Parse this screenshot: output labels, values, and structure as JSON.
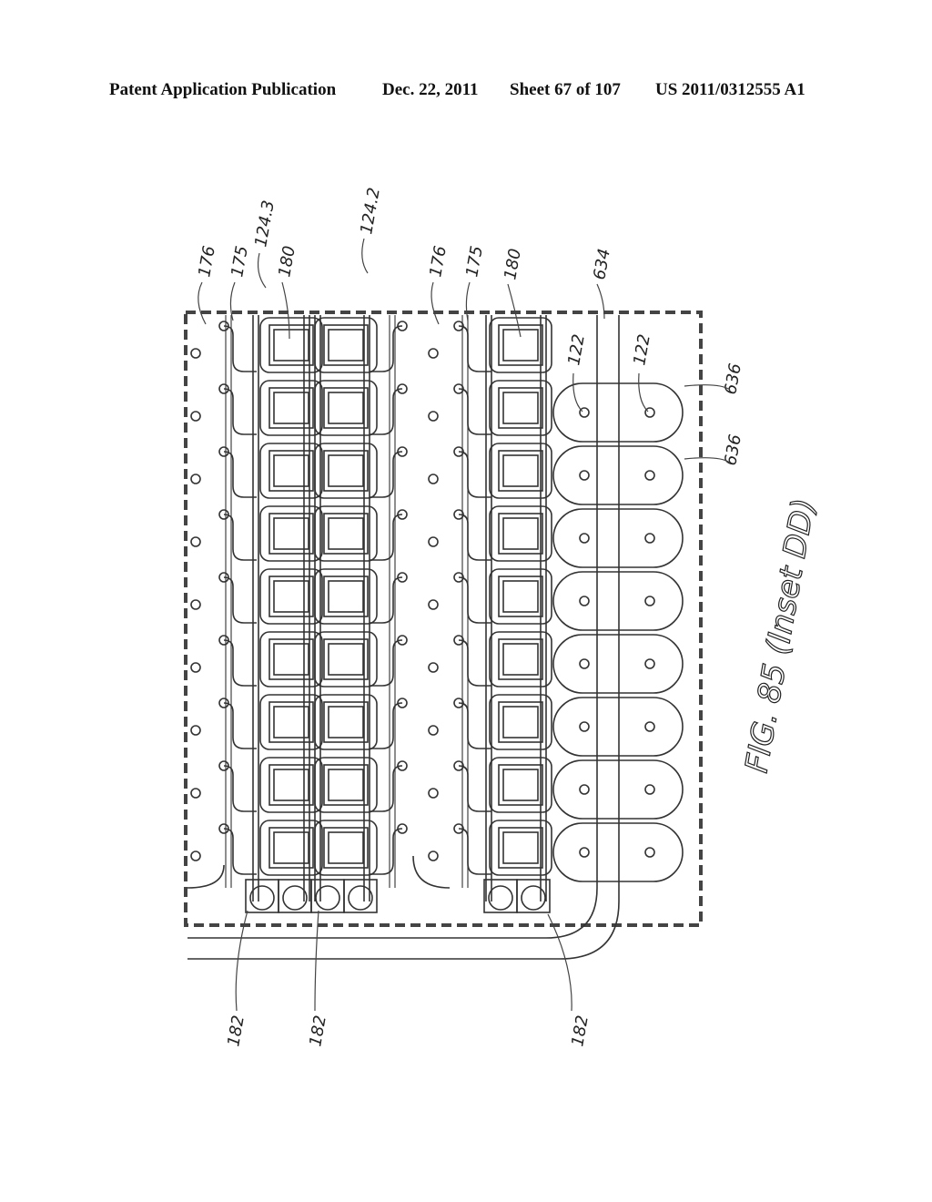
{
  "header": {
    "publication": "Patent Application Publication",
    "date": "Dec. 22, 2011",
    "sheet": "Sheet 67 of 107",
    "number": "US 2011/0312555 A1"
  },
  "figure": {
    "caption": "FIG. 85 (Inset DD)",
    "rows": 9,
    "chamber_columns": 3,
    "bubble_pairs": 8,
    "reference_labels": {
      "left_176": "176",
      "left_175": "175",
      "group_124_3": "124.3",
      "left_180": "180",
      "group_124_2": "124.2",
      "mid_176": "176",
      "mid_175": "175",
      "mid_180": "180",
      "channel_634": "634",
      "via_122_a": "122",
      "via_122_b": "122",
      "cell_636_a": "636",
      "cell_636_b": "636",
      "valve_182_a": "182",
      "valve_182_b": "182",
      "valve_182_c": "182"
    }
  }
}
